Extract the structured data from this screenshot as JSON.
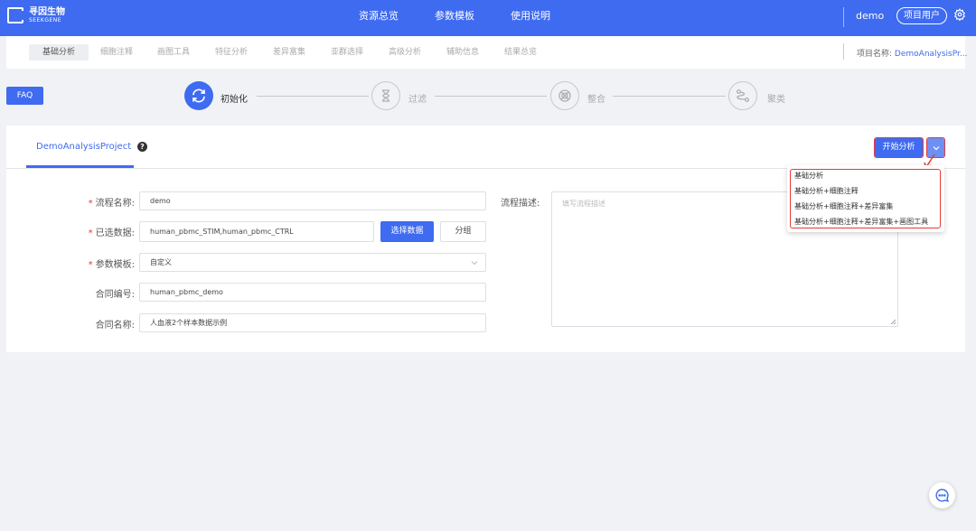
{
  "header": {
    "logo_cn": "寻因生物",
    "logo_en": "SEEKGENE",
    "nav": [
      "资源总览",
      "参数模板",
      "使用说明"
    ],
    "user_name": "demo",
    "user_role": "项目用户",
    "settings_icon": "gear-icon"
  },
  "subnav": {
    "tabs": [
      "基础分析",
      "细胞注释",
      "画图工具",
      "特征分析",
      "差异富集",
      "亚群选择",
      "高级分析",
      "辅助信息",
      "结果总览"
    ],
    "active_tab": "基础分析",
    "project_label": "项目名称:",
    "project_name": "DemoAnalysisPr..."
  },
  "faq": "FAQ",
  "steps": [
    {
      "label": "初始化",
      "icon": "refresh-icon",
      "active": true
    },
    {
      "label": "过滤",
      "icon": "hourglass-icon",
      "active": false
    },
    {
      "label": "整合",
      "icon": "integrate-icon",
      "active": false
    },
    {
      "label": "聚类",
      "icon": "cluster-icon",
      "active": false
    }
  ],
  "card": {
    "tab_label": "DemoAnalysisProject",
    "help": "?",
    "start_button": "开始分析"
  },
  "form": {
    "flow_name": {
      "label": "流程名称:",
      "value": "demo",
      "required": true
    },
    "selected_data": {
      "label": "已选数据:",
      "value": "human_pbmc_STIM,human_pbmc_CTRL",
      "required": true
    },
    "select_data_button": "选择数据",
    "group_button": "分组",
    "param_template": {
      "label": "参数模板:",
      "value": "自定义",
      "required": true
    },
    "contract_no": {
      "label": "合同编号:",
      "value": "human_pbmc_demo",
      "required": false
    },
    "contract_name": {
      "label": "合同名称:",
      "value": "人血液2个样本数据示例",
      "required": false
    },
    "flow_desc": {
      "label": "流程描述:",
      "placeholder": "填写流程描述"
    },
    "required_mark": "*"
  },
  "dropdown": {
    "items": [
      "基础分析",
      "基础分析+细胞注释",
      "基础分析+细胞注释+差异富集",
      "基础分析+细胞注释+差异富集+画图工具"
    ]
  },
  "colors": {
    "primary": "#3e6bf0",
    "highlight": "#e53935"
  }
}
